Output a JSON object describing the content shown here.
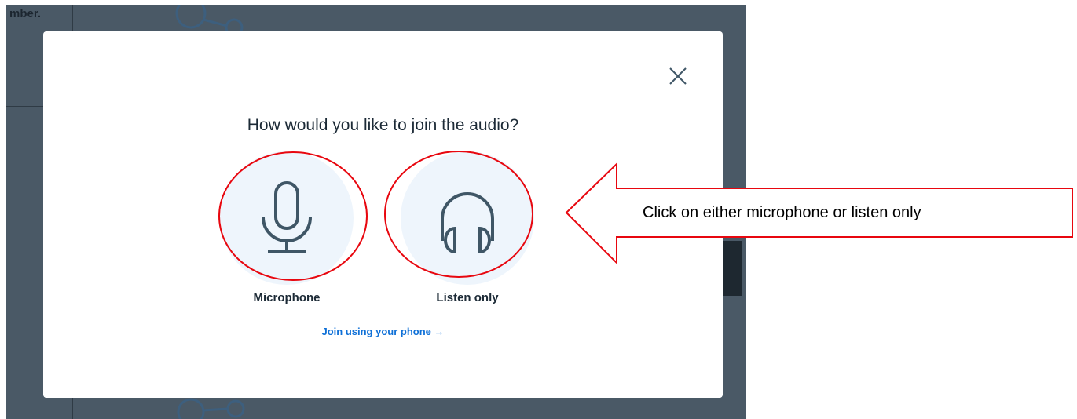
{
  "background": {
    "partial_text": "mber."
  },
  "modal": {
    "title": "How would you like to join the audio?",
    "options": [
      {
        "label": "Microphone",
        "icon": "microphone-icon"
      },
      {
        "label": "Listen only",
        "icon": "headphones-icon"
      }
    ],
    "phone_link": "Join using your phone →",
    "close_icon": "close-icon"
  },
  "annotation": {
    "callout_text": "Click on either microphone or listen only",
    "highlight_color": "#e8070f"
  },
  "colors": {
    "accent": "#0f70d7",
    "icon_stroke": "#3f5666",
    "option_bg": "#eef5fc",
    "backdrop": "#4a5966"
  }
}
